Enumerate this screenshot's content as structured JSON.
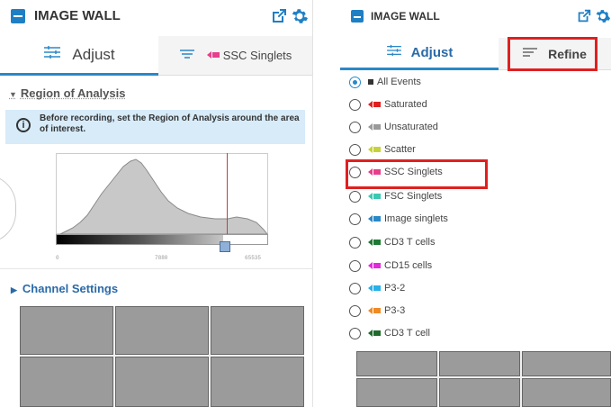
{
  "left_panel": {
    "title": "IMAGE WALL",
    "tabs": [
      {
        "label": "Adjust",
        "active": true
      },
      {
        "label": "SSC Singlets",
        "active": false,
        "swatch_color": "#e83e8c"
      }
    ],
    "region_section": "Region of Analysis",
    "info_text": "Before recording, set the Region of Analysis around the area of interest.",
    "axis_ticks": [
      "0",
      "7880",
      "65535"
    ],
    "channel_section": "Channel Settings"
  },
  "right_panel": {
    "title": "IMAGE WALL",
    "tabs": [
      {
        "label": "Adjust",
        "active": true
      },
      {
        "label": "Refine",
        "active": false
      }
    ],
    "populations": [
      {
        "label": "All Events",
        "color": "#333333",
        "selected": true,
        "arrow": false
      },
      {
        "label": "Saturated",
        "color": "#e02020",
        "selected": false,
        "arrow": true
      },
      {
        "label": "Unsaturated",
        "color": "#9a9a9a",
        "selected": false,
        "arrow": true
      },
      {
        "label": "Scatter",
        "color": "#c6d23b",
        "selected": false,
        "arrow": true
      },
      {
        "label": "SSC Singlets",
        "color": "#e83e8c",
        "selected": false,
        "arrow": true
      },
      {
        "label": "FSC Singlets",
        "color": "#3cc8b2",
        "selected": false,
        "arrow": true
      },
      {
        "label": "Image singlets",
        "color": "#2a88c8",
        "selected": false,
        "arrow": true
      },
      {
        "label": "CD3 T cells",
        "color": "#1e7a32",
        "selected": false,
        "arrow": true
      },
      {
        "label": "CD15 cells",
        "color": "#e02cd8",
        "selected": false,
        "arrow": true
      },
      {
        "label": "P3-2",
        "color": "#27b1e6",
        "selected": false,
        "arrow": true
      },
      {
        "label": "P3-3",
        "color": "#f08a24",
        "selected": false,
        "arrow": true
      },
      {
        "label": "CD3 T cell",
        "color": "#1f6b2c",
        "selected": false,
        "arrow": true
      }
    ]
  },
  "colors": {
    "accent": "#1f7fc4",
    "highlight": "#e02020",
    "info_bg": "#d7ebf9"
  },
  "icons": [
    "external-link-icon",
    "gear-icon",
    "sliders-icon",
    "filter-lines-icon",
    "info-icon",
    "caret-down-icon",
    "caret-right-icon"
  ]
}
